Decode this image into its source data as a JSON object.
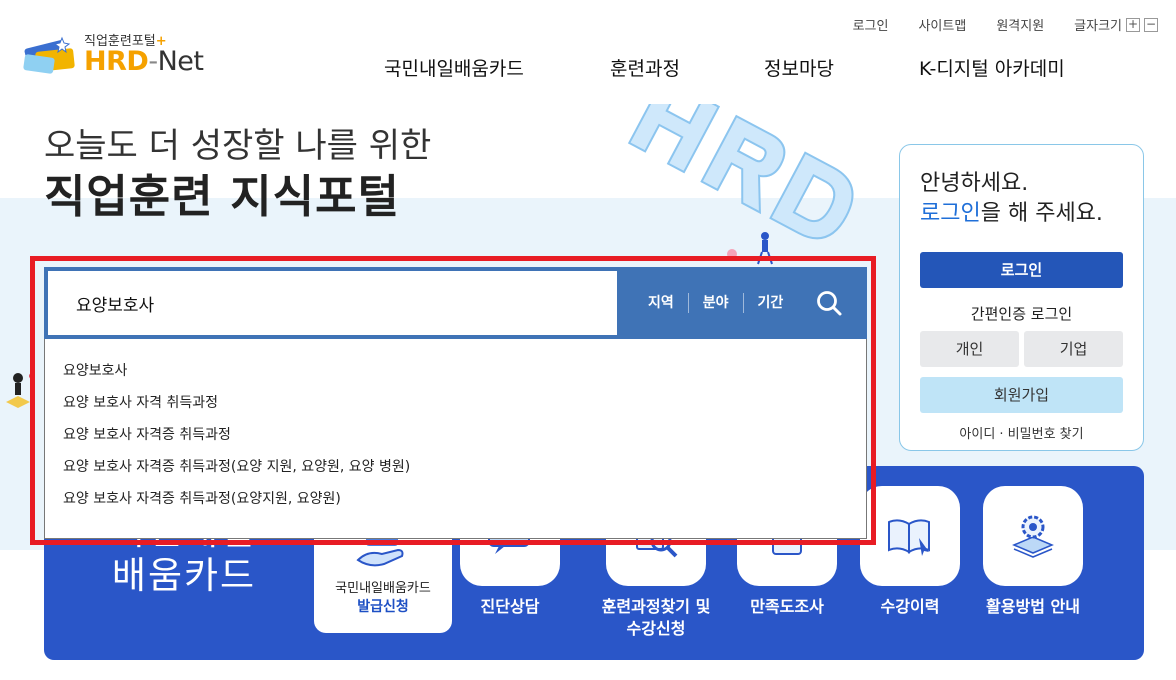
{
  "header": {
    "logo_sub": "직업훈련포털",
    "logo_plus": "+",
    "logo_hrd": "HRD",
    "logo_dash": "-",
    "logo_net": "Net",
    "util": {
      "login": "로그인",
      "sitemap": "사이트맵",
      "remote": "원격지원",
      "fontsize": "글자크기",
      "plus": "+",
      "minus": "−"
    },
    "nav": [
      "국민내일배움카드",
      "훈련과정",
      "정보마당",
      "K-디지털 아카데미"
    ]
  },
  "hero": {
    "line1": "오늘도 더 성장할 나를 위한",
    "line2": "직업훈련 지식포털"
  },
  "search": {
    "value": "요양보호사",
    "filters": [
      "지역",
      "분야",
      "기간"
    ],
    "suggestions": [
      "요양보호사",
      "요양 보호사 자격 취득과정",
      "요양 보호사 자격증 취득과정",
      "요양 보호사 자격증 취득과정(요양 지원, 요양원, 요양 병원)",
      "요양 보호사 자격증 취득과정(요양지원, 요양원)"
    ]
  },
  "login_panel": {
    "greeting": "안녕하세요.",
    "prompt_link": "로그인",
    "prompt_rest": "을 해 주세요.",
    "login_button": "로그인",
    "easy_login": "간편인증 로그인",
    "personal": "개인",
    "company": "기업",
    "join": "회원가입",
    "find": "아이디 · 비밀번호 찾기"
  },
  "card_section": {
    "title_line1": "국민내일",
    "title_line2": "배움카드",
    "feature_line1": "국민내일배움카드",
    "feature_line2": "발급신청",
    "services": [
      {
        "label": "진단상담"
      },
      {
        "label": "훈련과정찾기 및\n수강신청"
      },
      {
        "label": "만족도조사"
      },
      {
        "label": "수강이력"
      },
      {
        "label": "활용방법 안내"
      }
    ]
  },
  "colors": {
    "accent_blue": "#2a56c8",
    "search_bar": "#3f73b6",
    "highlight_red": "#e81c24",
    "logo_orange": "#f5a100"
  }
}
